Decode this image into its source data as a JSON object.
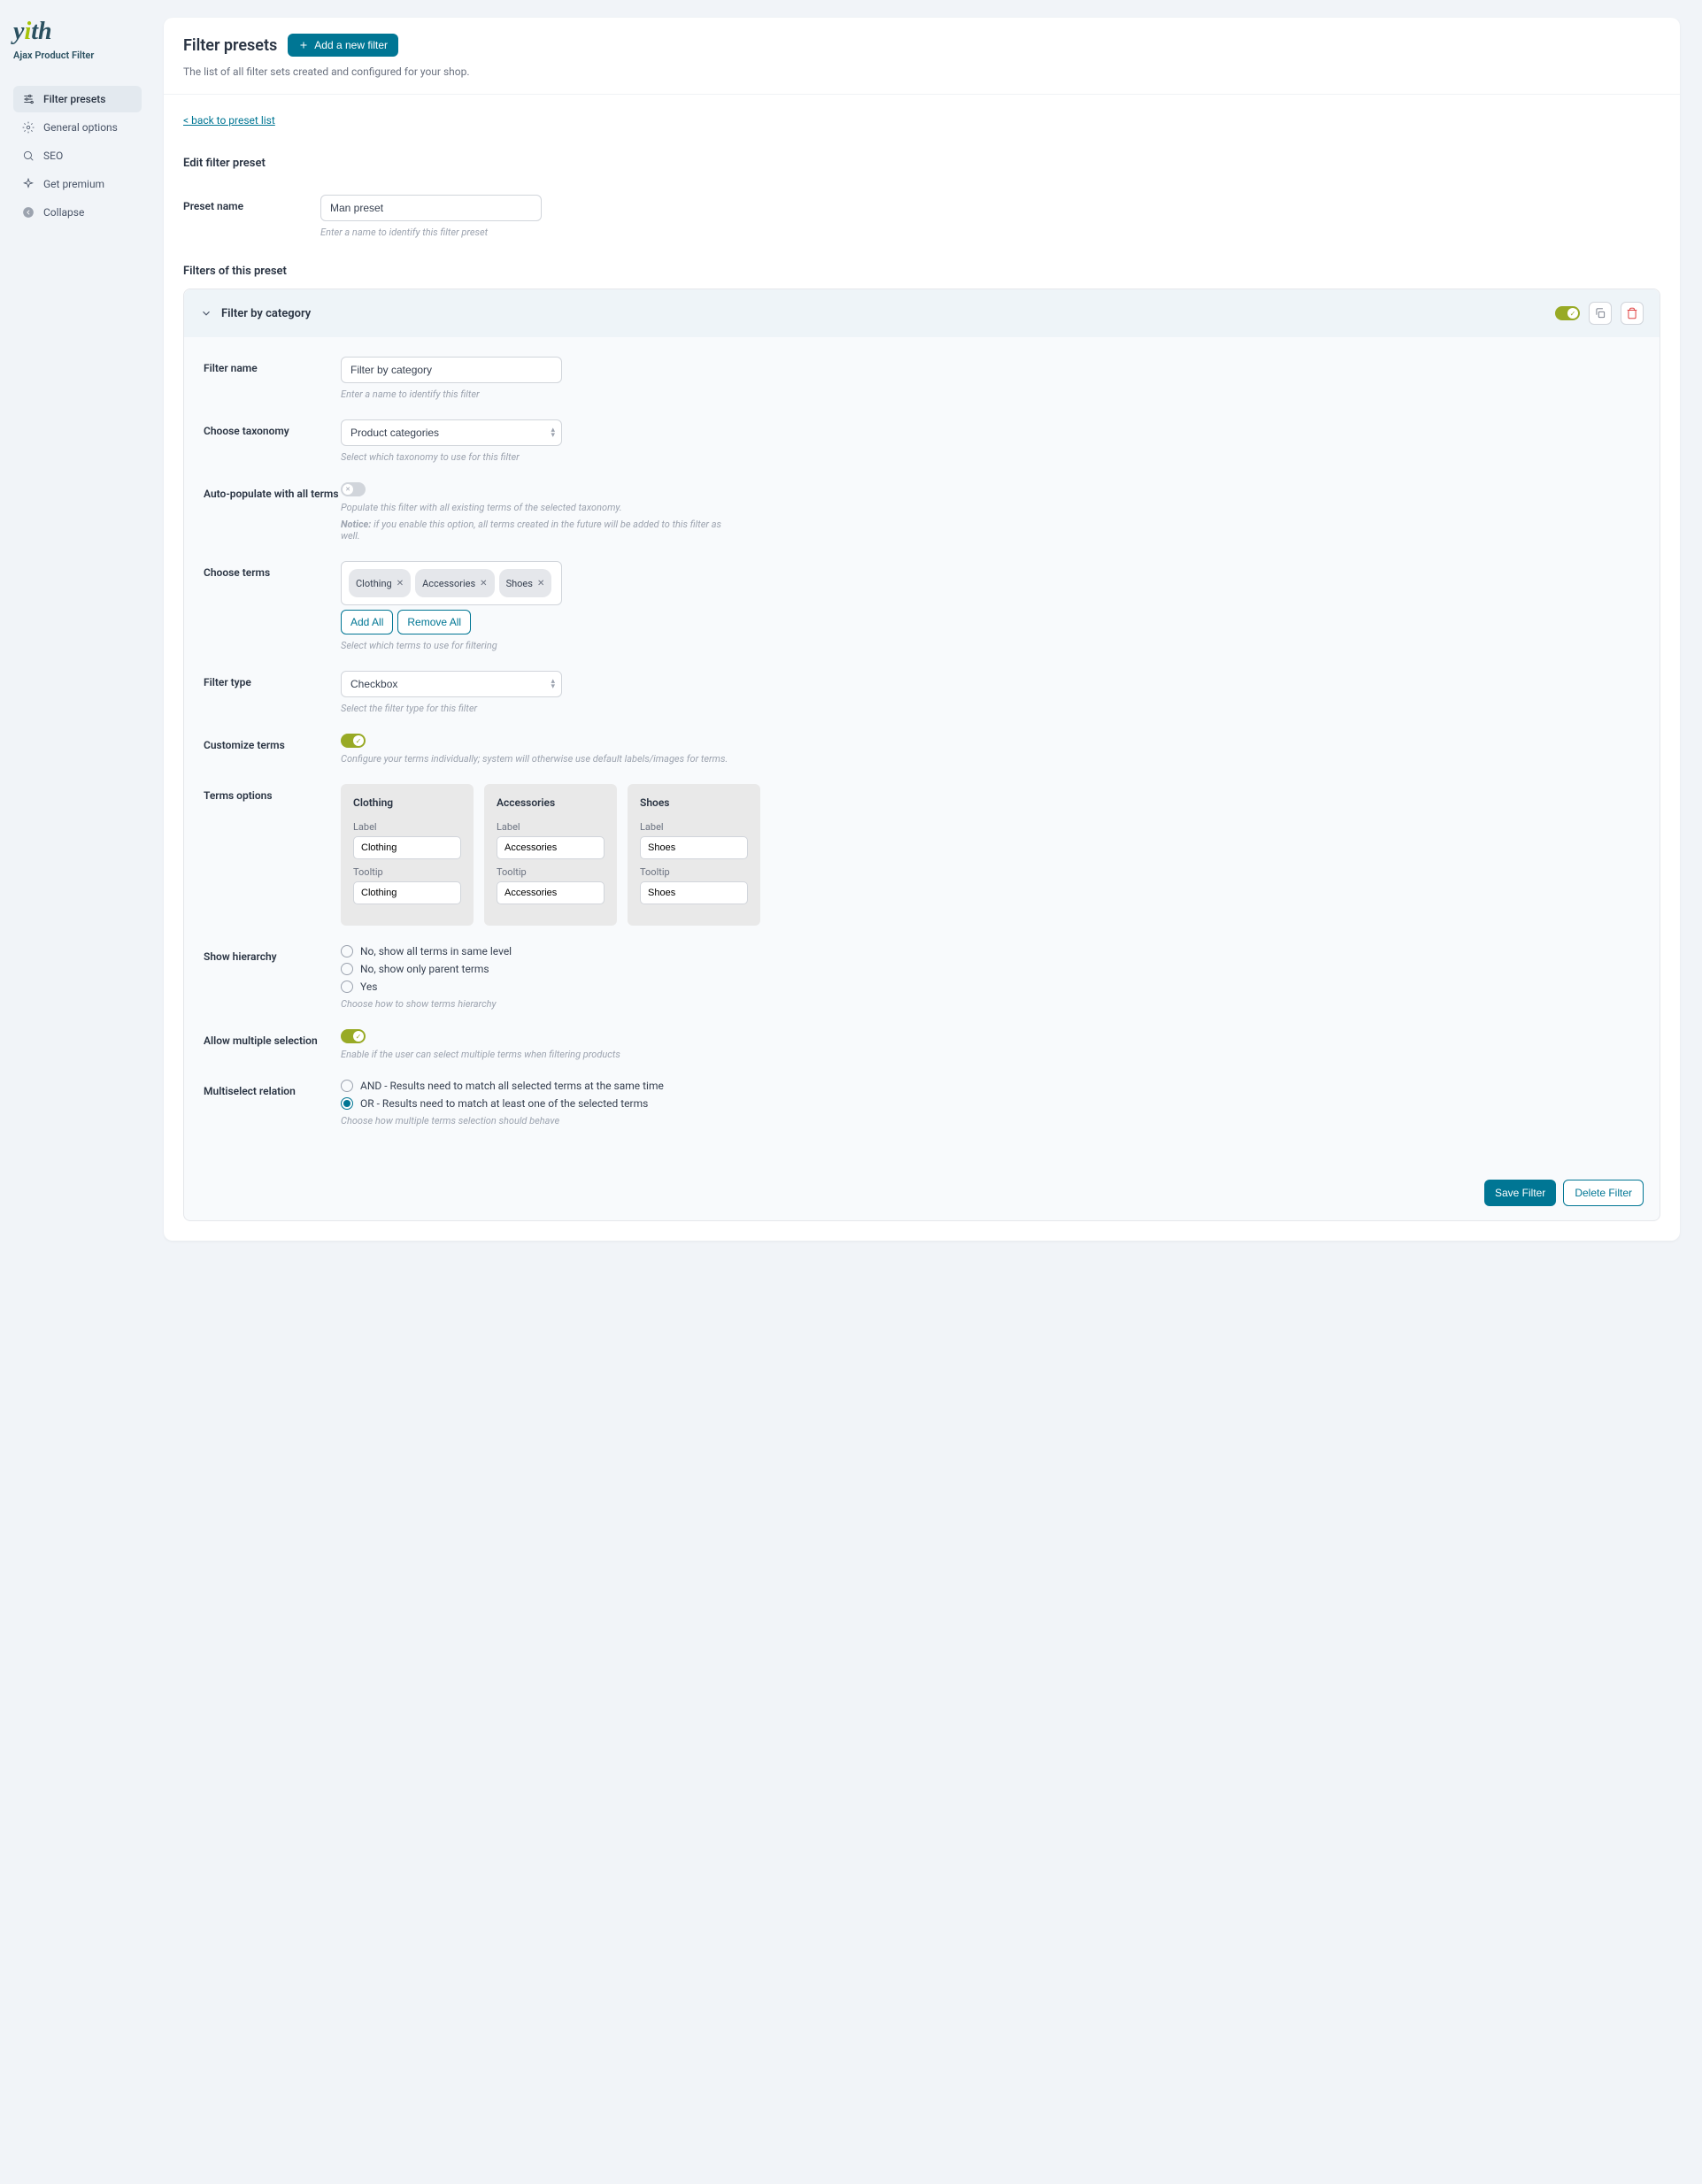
{
  "brand": {
    "name": "yith",
    "subtitle": "Ajax Product Filter"
  },
  "nav": {
    "presets": "Filter presets",
    "general": "General options",
    "seo": "SEO",
    "premium": "Get premium",
    "collapse": "Collapse"
  },
  "header": {
    "title": "Filter presets",
    "add_button": "Add a new filter",
    "subtitle": "The list of all filter sets created and configured for your shop."
  },
  "back_link": "< back to preset list",
  "edit": {
    "title": "Edit filter preset",
    "preset_name_label": "Preset name",
    "preset_name_value": "Man preset",
    "preset_name_help": "Enter a name to identify this filter preset",
    "filters_title": "Filters of this preset"
  },
  "panel": {
    "title": "Filter by category",
    "fields": {
      "filter_name": {
        "label": "Filter name",
        "value": "Filter by category",
        "help": "Enter a name to identify this filter"
      },
      "taxonomy": {
        "label": "Choose taxonomy",
        "value": "Product categories",
        "help": "Select which taxonomy to use for this filter"
      },
      "autopop": {
        "label": "Auto-populate with all terms",
        "help": "Populate this filter with all existing terms of the selected taxonomy.",
        "notice_label": "Notice:",
        "notice": " if you enable this option, all terms created in the future will be added to this filter as well."
      },
      "terms": {
        "label": "Choose terms",
        "tags": [
          "Clothing",
          "Accessories",
          "Shoes"
        ],
        "add_all": "Add All",
        "remove_all": "Remove All",
        "help": "Select which terms to use for filtering"
      },
      "filter_type": {
        "label": "Filter type",
        "value": "Checkbox",
        "help": "Select the filter type for this filter"
      },
      "customize": {
        "label": "Customize terms",
        "help": "Configure your terms individually; system will otherwise use default labels/images for terms."
      },
      "terms_options": {
        "label": "Terms options",
        "label_label": "Label",
        "tooltip_label": "Tooltip",
        "cards": [
          {
            "title": "Clothing",
            "label": "Clothing",
            "tooltip": "Clothing"
          },
          {
            "title": "Accessories",
            "label": "Accessories",
            "tooltip": "Accessories"
          },
          {
            "title": "Shoes",
            "label": "Shoes",
            "tooltip": "Shoes"
          }
        ]
      },
      "hierarchy": {
        "label": "Show hierarchy",
        "options": [
          "No, show all terms in same level",
          "No, show only parent terms",
          "Yes"
        ],
        "help": "Choose how to show terms hierarchy"
      },
      "multiple": {
        "label": "Allow multiple selection",
        "help": "Enable if the user can select multiple terms when filtering products"
      },
      "relation": {
        "label": "Multiselect relation",
        "options": [
          "AND - Results need to match all selected terms at the same time",
          "OR - Results need to match at least one of the selected terms"
        ],
        "selected": 1,
        "help": "Choose how multiple terms selection should behave"
      }
    },
    "save": "Save Filter",
    "delete": "Delete Filter"
  }
}
